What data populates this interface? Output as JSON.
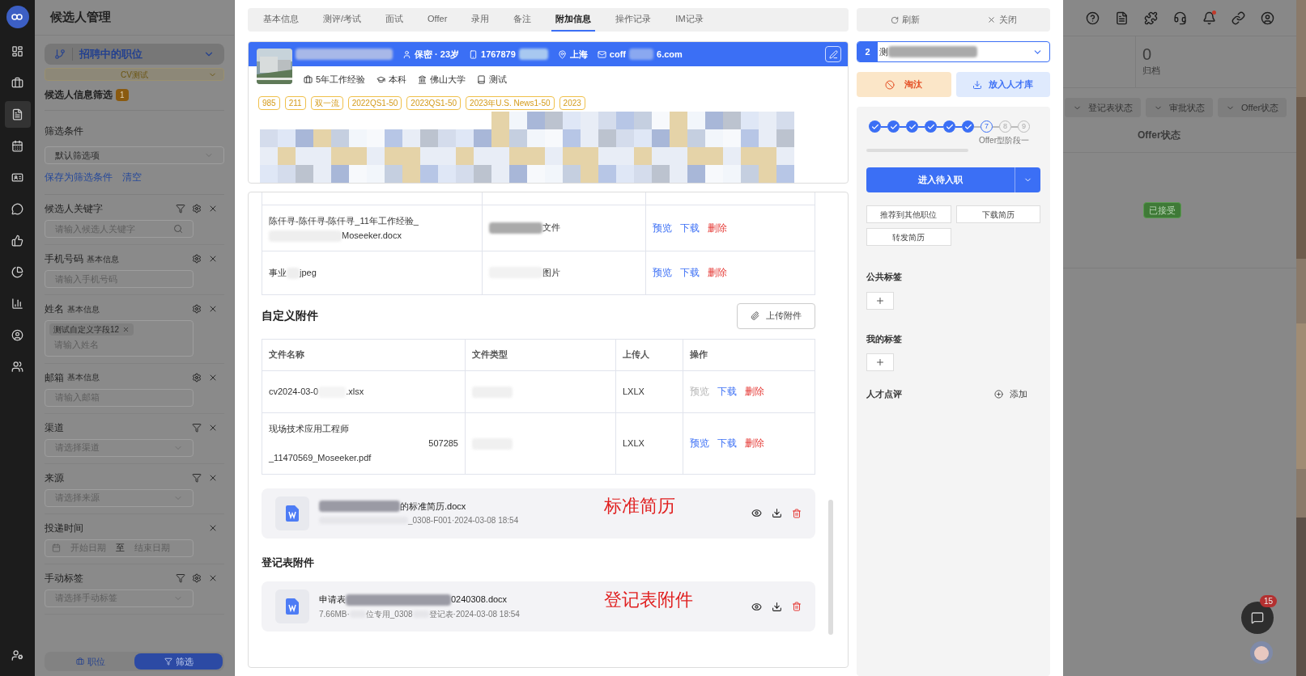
{
  "rail": {
    "items": [
      {
        "selected": false
      },
      {
        "selected": false
      },
      {
        "selected": true
      },
      {
        "selected": false
      },
      {
        "selected": false
      },
      {
        "selected": false
      },
      {
        "selected": false
      },
      {
        "selected": false
      },
      {
        "selected": false
      },
      {
        "selected": false
      },
      {
        "selected": false
      }
    ]
  },
  "left_panel": {
    "title": "候选人管理",
    "position_select": "招聘中的职位",
    "job_select": "CV测试",
    "filter_title": "候选人信息筛选",
    "filter_count": "1",
    "conditions_label": "筛选条件",
    "conditions_select": "默认筛选项",
    "links": [
      "保存为筛选条件",
      "清空"
    ],
    "fields": [
      {
        "kind": "search",
        "label": "候选人关键字",
        "filter": true,
        "settings": true,
        "placeholder": "请输入候选人关键字"
      },
      {
        "kind": "text",
        "label": "手机号码",
        "sub": "基本信息",
        "filter": false,
        "settings": true,
        "placeholder": "请输入手机号码"
      },
      {
        "kind": "tags",
        "label": "姓名",
        "sub": "基本信息",
        "filter": false,
        "settings": true,
        "tags": [
          "测试自定义字段12"
        ],
        "placeholder": "请输入姓名"
      },
      {
        "kind": "text",
        "label": "邮箱",
        "sub": "基本信息",
        "filter": false,
        "settings": true,
        "placeholder": "请输入邮箱"
      },
      {
        "kind": "select",
        "label": "渠道",
        "filter": true,
        "settings": false,
        "placeholder": "请选择渠道"
      },
      {
        "kind": "select",
        "label": "来源",
        "filter": true,
        "settings": false,
        "placeholder": "请选择来源"
      },
      {
        "kind": "date",
        "label": "投递时间",
        "filter": false,
        "settings": false,
        "start": "开始日期",
        "sep": "至",
        "end": "结束日期"
      },
      {
        "kind": "select",
        "label": "手动标签",
        "filter": true,
        "settings": true,
        "placeholder": "请选择手动标签"
      }
    ],
    "bottom_tabs": [
      {
        "label": "职位",
        "selected": false
      },
      {
        "label": "筛选",
        "selected": true
      }
    ]
  },
  "drawer": {
    "tabs": [
      {
        "label": "基本信息",
        "selected": false
      },
      {
        "label": "测评/考试",
        "selected": false
      },
      {
        "label": "面试",
        "selected": false
      },
      {
        "label": "Offer",
        "selected": false
      },
      {
        "label": "录用",
        "selected": false
      },
      {
        "label": "备注",
        "selected": false
      },
      {
        "label": "附加信息",
        "selected": true
      },
      {
        "label": "操作记录",
        "selected": false
      },
      {
        "label": "IM记录",
        "selected": false
      }
    ],
    "profile": {
      "gender_age": "保密 · 23岁",
      "phone": "1767879",
      "city": "上海",
      "email_start": "coff",
      "email_end": "6.com",
      "info": [
        "5年工作经验",
        "本科",
        "佛山大学",
        "测试"
      ],
      "tags": [
        "985",
        "211",
        "双一流",
        "2022QS1-50",
        "2023QS1-50",
        "2023年U.S. News1-50",
        "2023"
      ]
    },
    "attachments": {
      "rows": [
        {
          "name": [
            "陈仟寻-陈仟寻-陈仟寻_11年工作经验_",
            "Moseeker.docx"
          ],
          "type": "文件",
          "actions": [
            {
              "kind": "preview",
              "label": "预览",
              "disabled": false
            },
            {
              "kind": "download",
              "label": "下载",
              "disabled": false
            },
            {
              "kind": "delete",
              "label": "删除",
              "disabled": false
            }
          ]
        },
        {
          "name": [
            "事业",
            "jpeg"
          ],
          "type": "图片",
          "actions": [
            {
              "kind": "preview",
              "label": "预览",
              "disabled": false
            },
            {
              "kind": "download",
              "label": "下载",
              "disabled": false
            },
            {
              "kind": "delete",
              "label": "删除",
              "disabled": false
            }
          ]
        }
      ]
    },
    "custom": {
      "title": "自定义附件",
      "upload": "上传附件",
      "columns": [
        "文件名称",
        "文件类型",
        "上传人",
        "操作"
      ],
      "rows": [
        {
          "name": [
            "cv2024-03-0",
            ".xlsx"
          ],
          "uploader": "LXLX",
          "actions": [
            {
              "kind": "preview",
              "label": "预览",
              "disabled": true
            },
            {
              "kind": "download",
              "label": "下载",
              "disabled": false
            },
            {
              "kind": "delete",
              "label": "删除",
              "disabled": false
            }
          ]
        },
        {
          "name": [
            "现场技术应用工程师",
            "507285",
            "_11470569_Moseeker.pdf"
          ],
          "uploader": "LXLX",
          "actions": [
            {
              "kind": "preview",
              "label": "预览",
              "disabled": false
            },
            {
              "kind": "download",
              "label": "下载",
              "disabled": false
            },
            {
              "kind": "delete",
              "label": "删除",
              "disabled": false
            }
          ]
        }
      ]
    },
    "standard": {
      "name": "的标准简历.docx",
      "meta": "_0308-F001·2024-03-08 18:54",
      "annotation": "标准简历"
    },
    "register": {
      "title": "登记表附件",
      "name_start": "申请表",
      "name_end": "0240308.docx",
      "meta": [
        "7.66MB·",
        "位专用_0308",
        "登记表·2024-03-08 18:54"
      ],
      "annotation": "登记表附件"
    }
  },
  "side": {
    "refresh": "刷新",
    "close": "关闭",
    "candidate_index": "2",
    "candidate_name": "测",
    "reject": "淘汰",
    "pool": "放入人才库",
    "steps": [
      {
        "kind": "done"
      },
      {
        "kind": "done"
      },
      {
        "kind": "done"
      },
      {
        "kind": "done"
      },
      {
        "kind": "done"
      },
      {
        "kind": "done"
      },
      {
        "kind": "current",
        "number": "7"
      },
      {
        "kind": "todo",
        "number": "8"
      },
      {
        "kind": "todo",
        "number": "9"
      }
    ],
    "step_caption": "Offer型阶段一",
    "primary": "进入待入职",
    "buttons": [
      "推荐到其他职位",
      "下载简历",
      "转发简历"
    ],
    "public_tags": "公共标签",
    "my_tags": "我的标签",
    "review": "人才点评",
    "review_add": "添加"
  },
  "background": {
    "notification_dot": true,
    "stat_value": "0",
    "stat_label": "归档",
    "filters": [
      "登记表状态",
      "审批状态",
      "Offer状态"
    ],
    "column": "Offer状态",
    "status_badge": "已接受",
    "chat_count": "15"
  }
}
